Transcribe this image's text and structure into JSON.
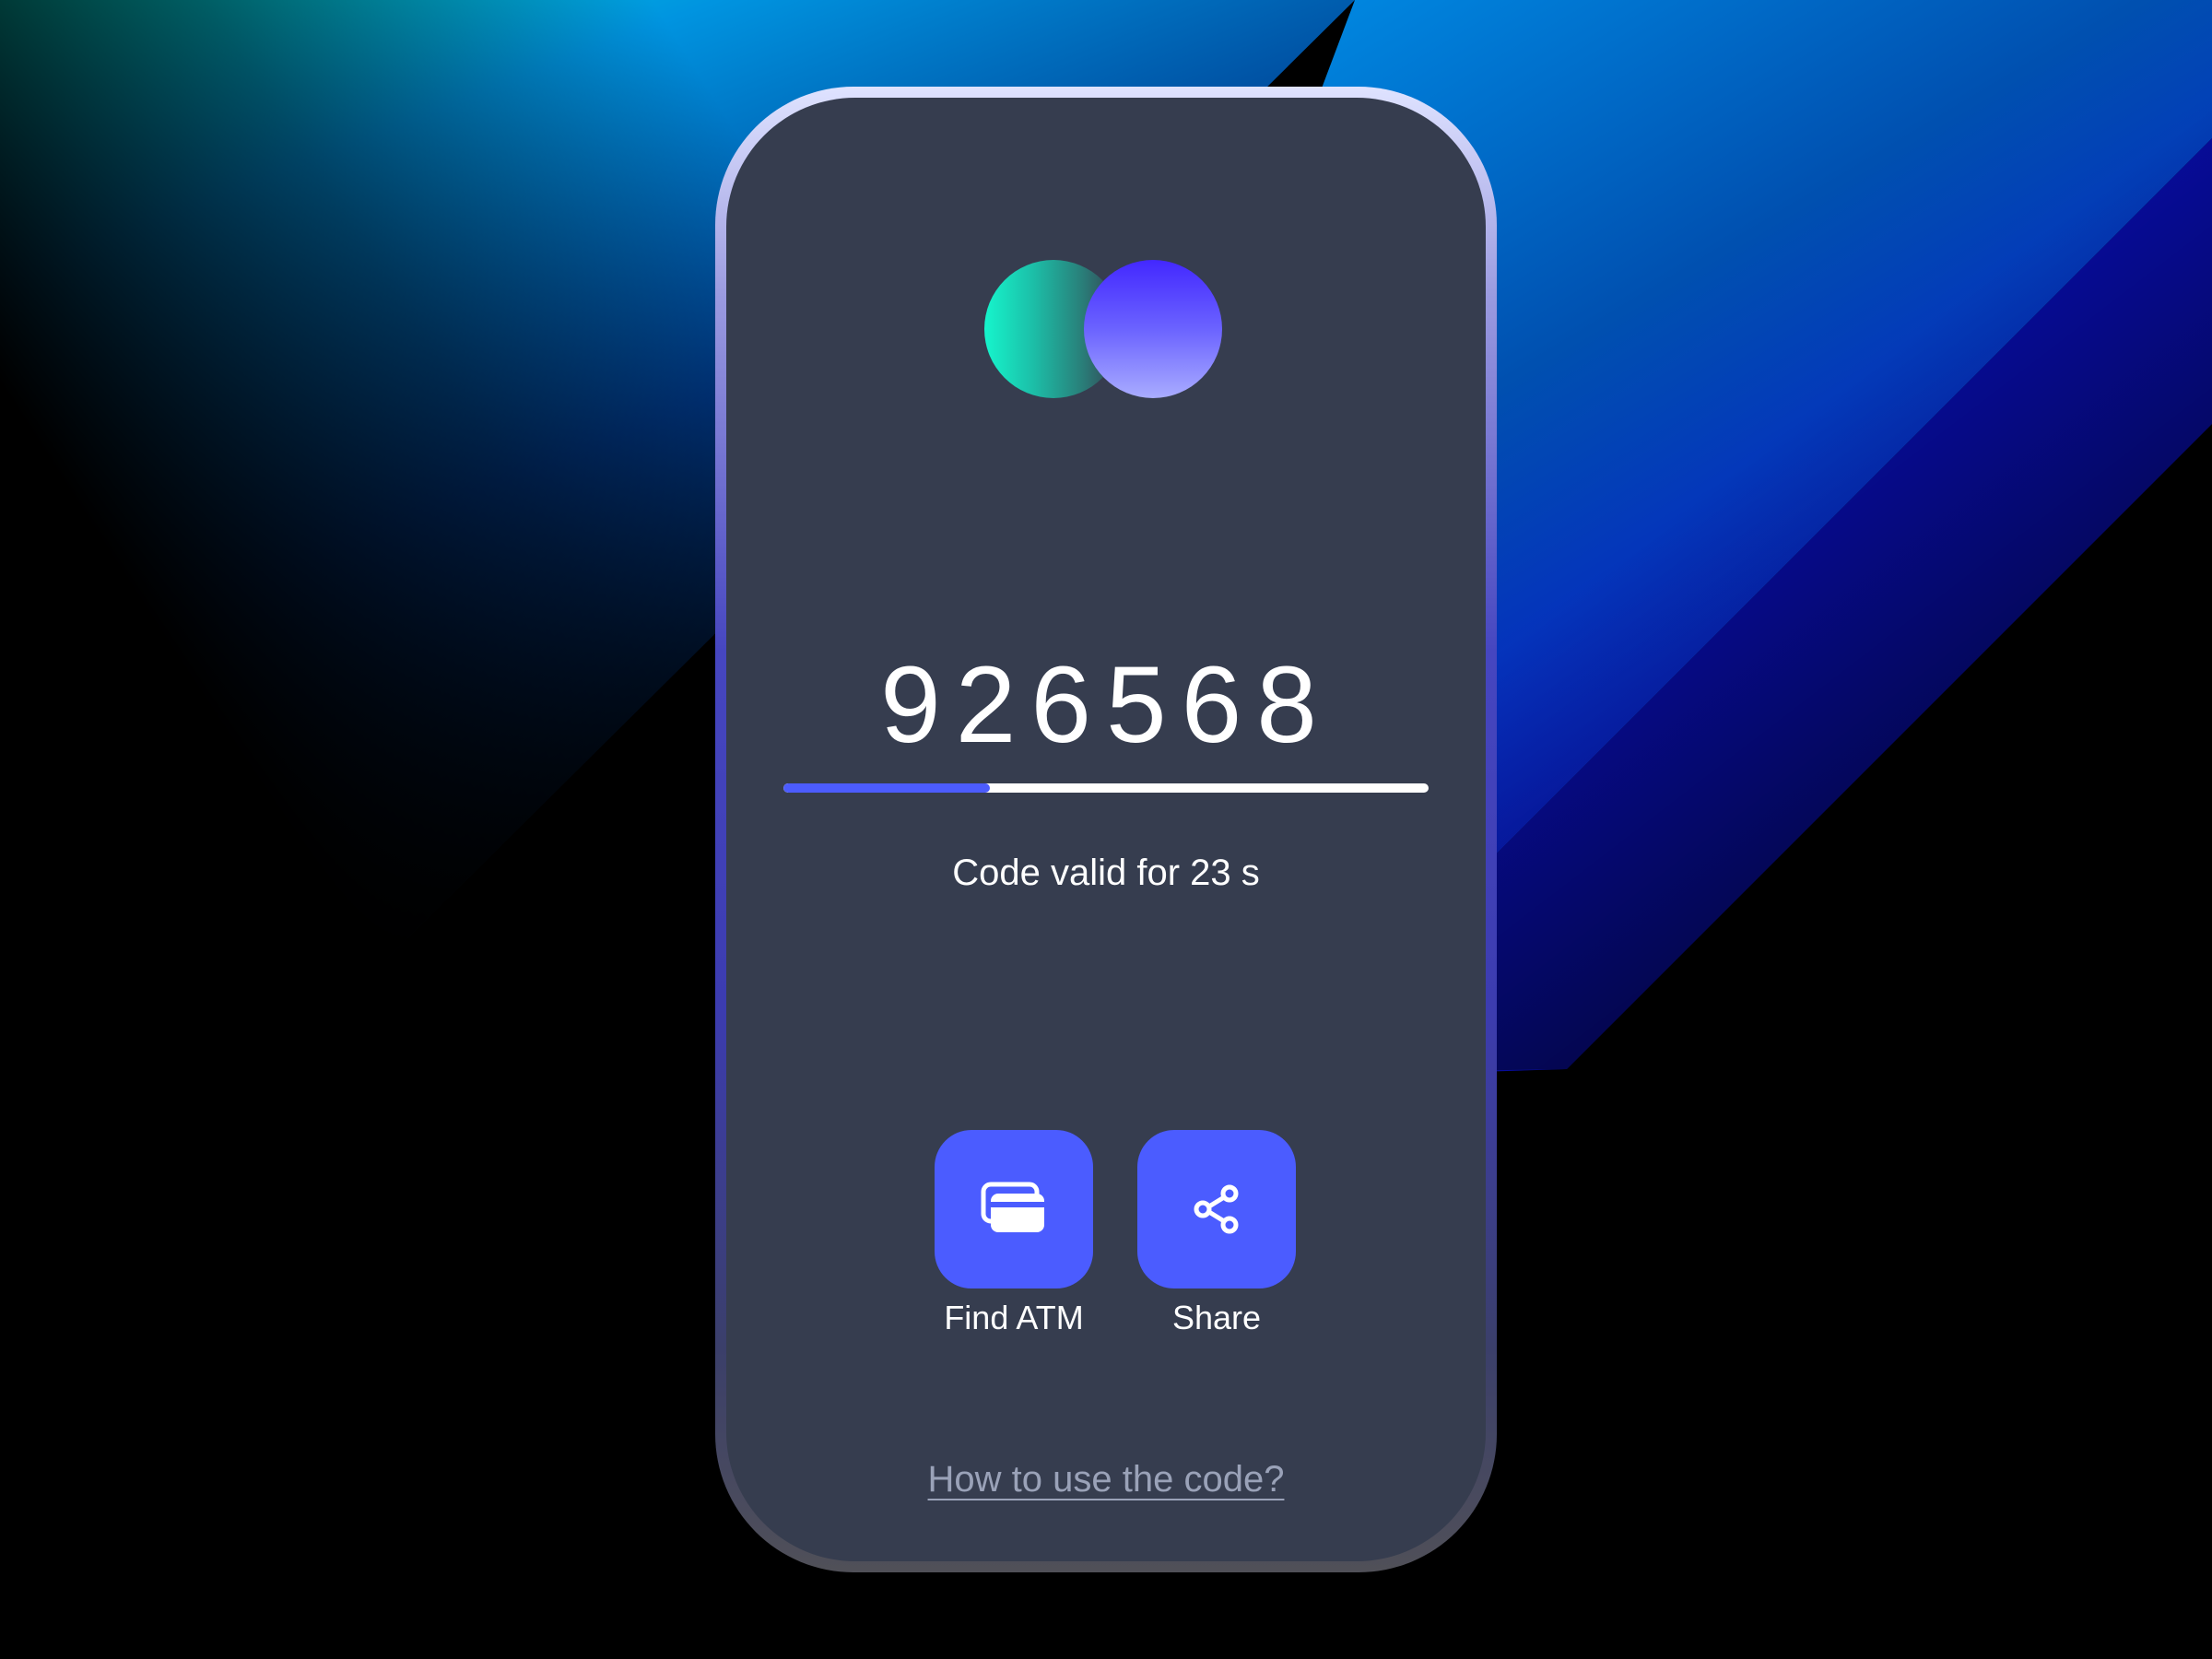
{
  "otp": {
    "code": "926568",
    "valid_prefix": "Code valid for",
    "seconds": "23",
    "unit": "s",
    "progress_fraction": 0.32
  },
  "actions": [
    {
      "label": "Find ATM",
      "icon": "card-icon"
    },
    {
      "label": "Share",
      "icon": "share-icon"
    }
  ],
  "help_link": "How to use the code?",
  "colors": {
    "accent": "#4b5cff",
    "screen": "#363d4f",
    "logo_teal": "#16f5cc",
    "logo_violet": "#4328ff"
  }
}
